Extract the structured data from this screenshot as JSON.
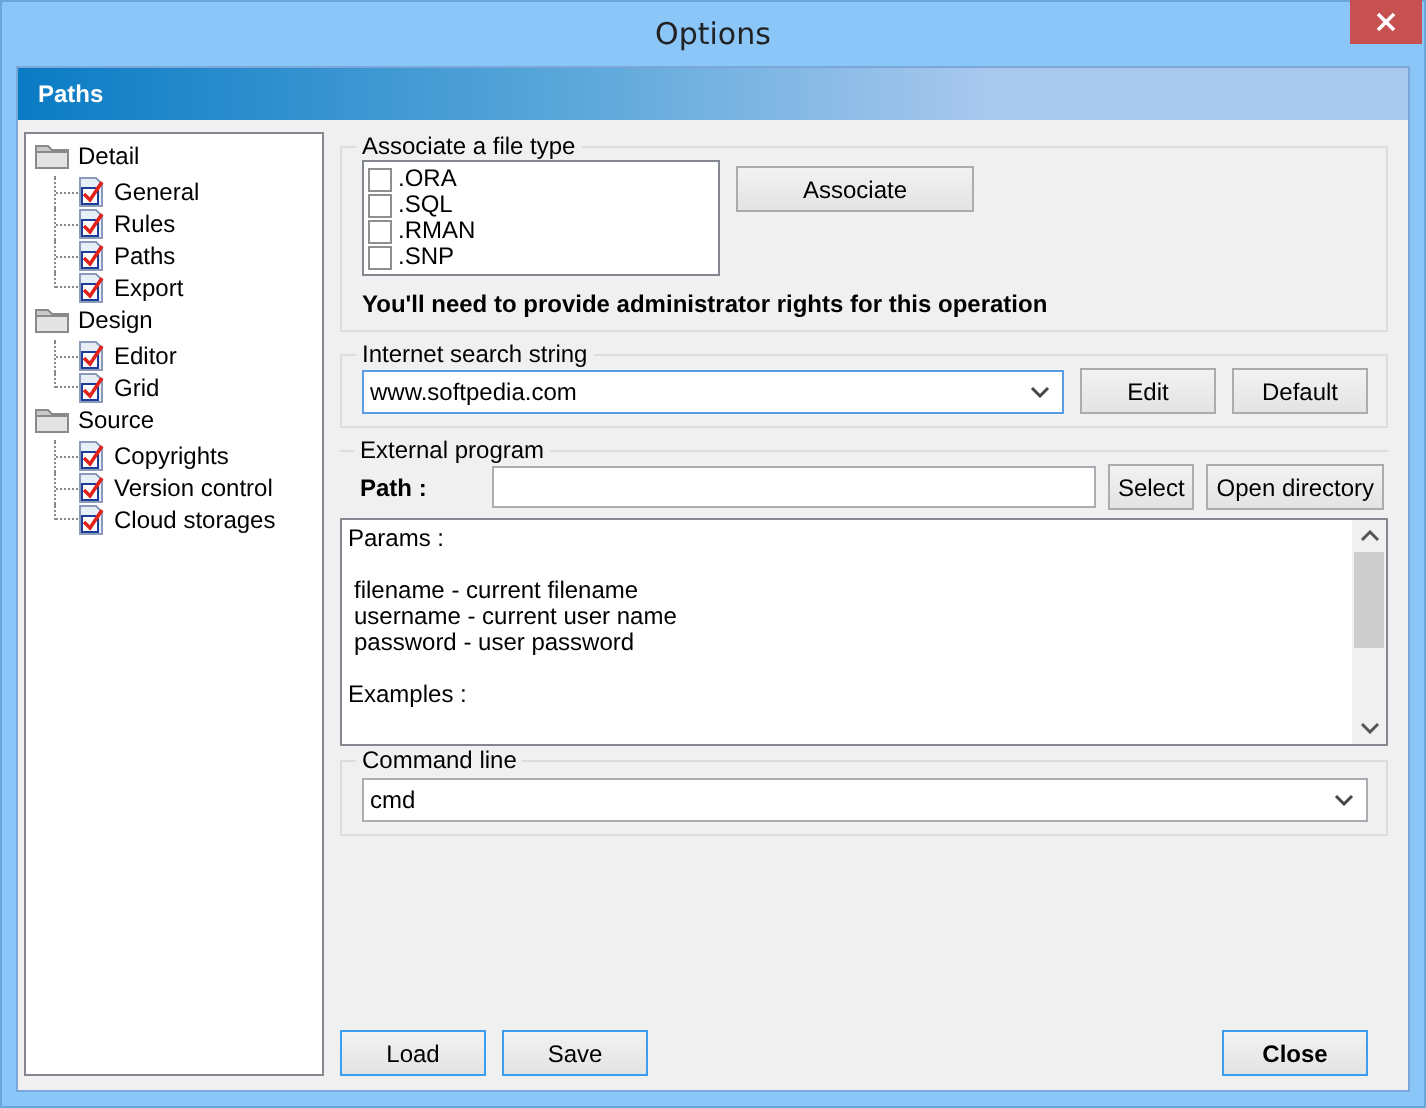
{
  "window": {
    "title": "Options"
  },
  "header": {
    "title": "Paths"
  },
  "tree": [
    {
      "label": "Detail",
      "children": [
        {
          "label": "General"
        },
        {
          "label": "Rules"
        },
        {
          "label": "Paths"
        },
        {
          "label": "Export"
        }
      ]
    },
    {
      "label": "Design",
      "children": [
        {
          "label": "Editor"
        },
        {
          "label": "Grid"
        }
      ]
    },
    {
      "label": "Source",
      "children": [
        {
          "label": "Copyrights"
        },
        {
          "label": "Version control"
        },
        {
          "label": "Cloud storages"
        }
      ]
    }
  ],
  "associate": {
    "title": "Associate a file type",
    "file_types": [
      {
        "label": ".ORA",
        "checked": false
      },
      {
        "label": ".SQL",
        "checked": false
      },
      {
        "label": ".RMAN",
        "checked": false
      },
      {
        "label": ".SNP",
        "checked": false
      }
    ],
    "button": "Associate",
    "note": "You'll need to provide administrator rights for this operation"
  },
  "search": {
    "title": "Internet search string",
    "value": "www.softpedia.com",
    "buttons": [
      "Edit",
      "Default"
    ]
  },
  "external": {
    "title": "External program",
    "path_label": "Path :",
    "buttons": [
      "Select",
      "Open directory"
    ],
    "memo": [
      {
        "kind": "heading",
        "text": "Params :"
      },
      {
        "kind": "param",
        "text": "filename - current filename"
      },
      {
        "kind": "param",
        "text": "username - current user name"
      },
      {
        "kind": "param",
        "text": "password - user password"
      },
      {
        "kind": "heading",
        "text": "Examples :"
      }
    ]
  },
  "command": {
    "title": "Command line",
    "value": "cmd"
  },
  "footer_buttons": [
    {
      "label": "Load",
      "default": false
    },
    {
      "label": "Save",
      "default": false
    },
    {
      "label": "Close",
      "default": true
    }
  ]
}
